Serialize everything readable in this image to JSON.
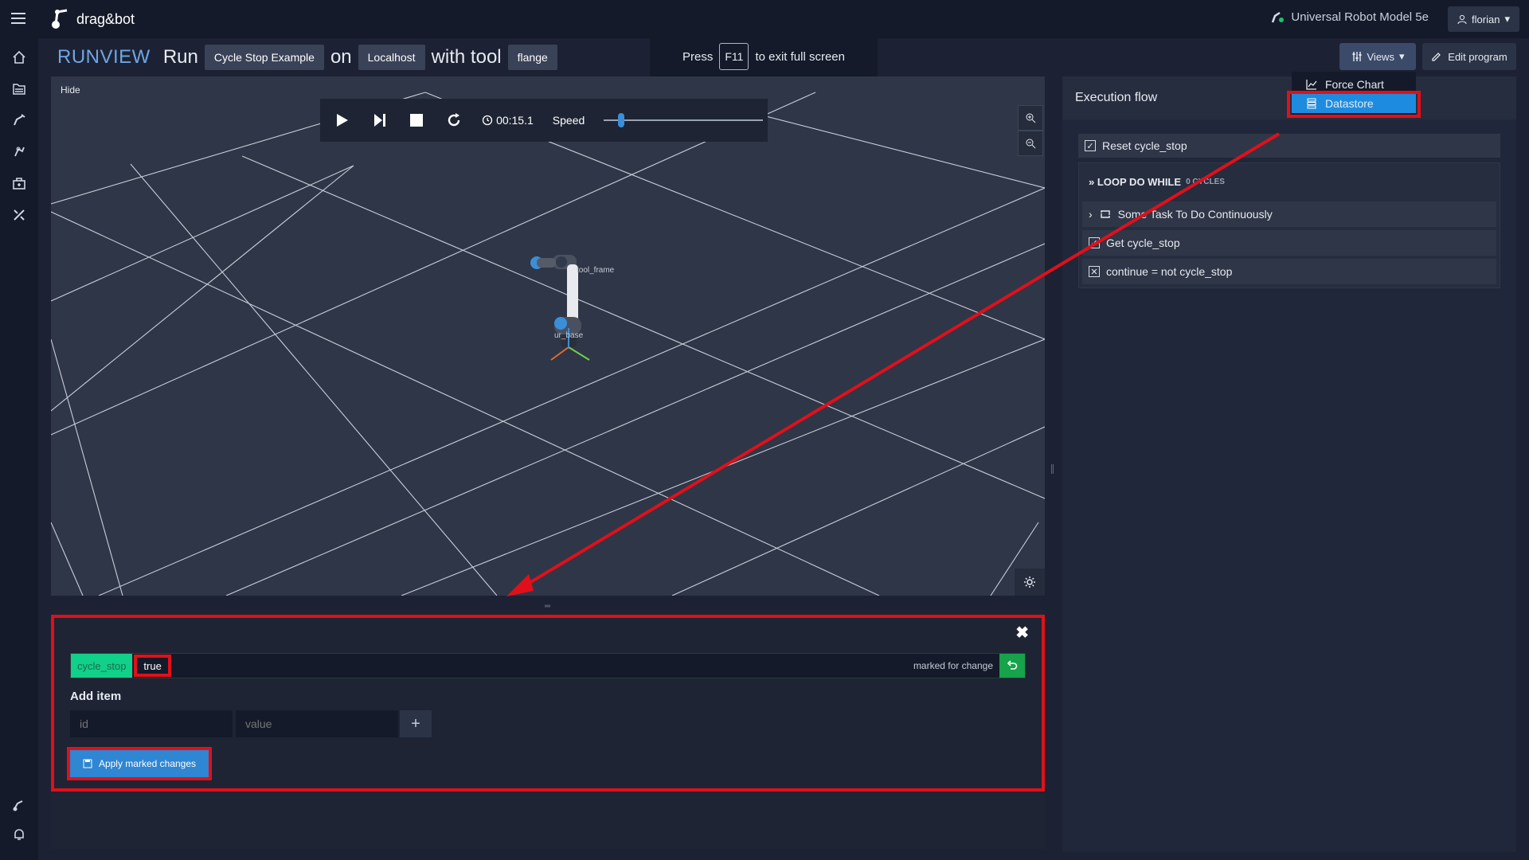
{
  "app": {
    "name": "drag&bot"
  },
  "topbar": {
    "robot_model": "Universal Robot Model 5e",
    "user": "florian"
  },
  "header": {
    "runview": "RUNVIEW",
    "run_word": "Run",
    "program": "Cycle Stop Example",
    "on_word": "on",
    "host": "Localhost",
    "with_tool_word": "with tool",
    "tool": "flange"
  },
  "fullscreen_banner": {
    "press": "Press",
    "key": "F11",
    "suffix": "to exit full screen"
  },
  "toolbar": {
    "views_label": "Views",
    "edit_label": "Edit program"
  },
  "views_menu": {
    "items": [
      {
        "label": "Force Chart",
        "icon": "chart-icon"
      },
      {
        "label": "Datastore",
        "icon": "database-icon",
        "selected": true
      }
    ]
  },
  "viewport": {
    "hide_label": "Hide",
    "timer": "00:15.1",
    "speed_label": "Speed",
    "speed_level": 0.1,
    "frames": {
      "tool": "tool_frame",
      "base": "ur_base"
    }
  },
  "datastore": {
    "entry": {
      "key": "cycle_stop",
      "value": "true",
      "status": "marked for change"
    },
    "add_title": "Add item",
    "id_placeholder": "id",
    "value_placeholder": "value",
    "apply_label": "Apply marked changes"
  },
  "execution_flow": {
    "title": "Execution flow",
    "items": [
      {
        "label": "Reset cycle_stop",
        "icon": "checkbox-checked-icon"
      }
    ],
    "loop": {
      "title": "» LOOP DO WHILE",
      "cycles": "0 CYCLES",
      "children": [
        {
          "label": "Some Task To Do Continuously",
          "icon": "loop-icon"
        },
        {
          "label": "Get cycle_stop",
          "icon": "checkbox-checked-icon"
        },
        {
          "label": "continue = not cycle_stop",
          "icon": "checkbox-x-icon"
        }
      ]
    }
  },
  "colors": {
    "accent_blue": "#1d8ce0",
    "highlight_red": "#e0101a",
    "key_green": "#11d089",
    "revert_green": "#16a34a"
  }
}
